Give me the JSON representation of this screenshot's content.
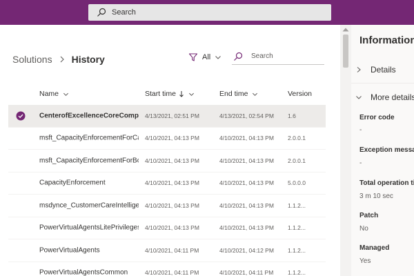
{
  "topbar": {
    "search_placeholder": "Search",
    "color": "#742774"
  },
  "breadcrumb": {
    "parent": "Solutions",
    "current": "History"
  },
  "filter": {
    "label": "All"
  },
  "search": {
    "placeholder": "Search"
  },
  "table": {
    "columns": {
      "name": "Name",
      "start": "Start time",
      "end": "End time",
      "version": "Version"
    },
    "rows": [
      {
        "name": "CenterofExcellenceCoreComponents",
        "start": "4/13/2021, 02:51 PM",
        "end": "4/13/2021, 02:54 PM",
        "version": "1.6"
      },
      {
        "name": "msft_CapacityEnforcementForCanvas",
        "start": "4/10/2021, 04:13 PM",
        "end": "4/10/2021, 04:13 PM",
        "version": "2.0.0.1"
      },
      {
        "name": "msft_CapacityEnforcementForBots",
        "start": "4/10/2021, 04:13 PM",
        "end": "4/10/2021, 04:13 PM",
        "version": "2.0.0.1"
      },
      {
        "name": "CapacityEnforcement",
        "start": "4/10/2021, 04:13 PM",
        "end": "4/10/2021, 04:13 PM",
        "version": "5.0.0.0"
      },
      {
        "name": "msdynce_CustomerCareIntelligence",
        "start": "4/10/2021, 04:13 PM",
        "end": "4/10/2021, 04:13 PM",
        "version": "1.1.2..."
      },
      {
        "name": "PowerVirtualAgentsLitePrivileges",
        "start": "4/10/2021, 04:13 PM",
        "end": "4/10/2021, 04:13 PM",
        "version": "1.1.2..."
      },
      {
        "name": "PowerVirtualAgents",
        "start": "4/10/2021, 04:11 PM",
        "end": "4/10/2021, 04:12 PM",
        "version": "1.1.2..."
      },
      {
        "name": "PowerVirtualAgentsCommon",
        "start": "4/10/2021, 04:11 PM",
        "end": "4/10/2021, 04:11 PM",
        "version": "1.1.2..."
      }
    ]
  },
  "panel": {
    "title": "Information",
    "sections": {
      "details": "Details",
      "more_details": "More details"
    },
    "fields": [
      {
        "label": "Error code",
        "value": "-"
      },
      {
        "label": "Exception message",
        "value": "-"
      },
      {
        "label": "Total operation time",
        "value": "3 m 10 sec"
      },
      {
        "label": "Patch",
        "value": "No"
      },
      {
        "label": "Managed",
        "value": "Yes"
      }
    ]
  },
  "icons": {
    "search": "search-icon",
    "filter": "filter-icon",
    "check": "checkmark-circle-icon",
    "chevron": "chevron-icon"
  }
}
